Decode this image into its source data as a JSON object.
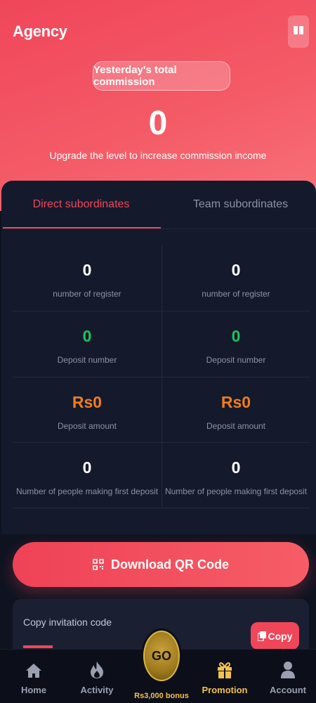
{
  "header": {
    "title": "Agency",
    "commission_label": "Yesterday's total commission",
    "commission_value": "0",
    "upgrade_text": "Upgrade the level to increase commission income"
  },
  "tabs": {
    "direct": "Direct subordinates",
    "team": "Team subordinates",
    "active": "direct"
  },
  "stats": [
    {
      "left": {
        "value": "0",
        "label": "number of register"
      },
      "right": {
        "value": "0",
        "label": "number of register"
      }
    },
    {
      "left": {
        "value": "0",
        "label": "Deposit number"
      },
      "right": {
        "value": "0",
        "label": "Deposit number"
      }
    },
    {
      "left": {
        "value": "Rs0",
        "label": "Deposit amount"
      },
      "right": {
        "value": "Rs0",
        "label": "Deposit amount"
      }
    },
    {
      "left": {
        "value": "0",
        "label": "Number of people making first deposit"
      },
      "right": {
        "value": "0",
        "label": "Number of people making first deposit"
      }
    }
  ],
  "actions": {
    "download_qr": "Download QR Code",
    "copy_invitation_label": "Copy invitation code",
    "copy_button": "Copy"
  },
  "nav": {
    "home": "Home",
    "activity": "Activity",
    "go": "GO",
    "bonus": "Rs3,000 bonus",
    "promotion": "Promotion",
    "account": "Account",
    "active": "promotion"
  },
  "colors": {
    "accent": "#f0465a",
    "green": "#21c05a",
    "orange": "#f07d1e",
    "gold": "#f2c14e",
    "panel": "#141a2b"
  },
  "icons": {
    "rules": "book-icon",
    "qr": "qr-code-icon",
    "copy": "copy-icon",
    "home": "home-icon",
    "activity": "flame-icon",
    "promotion": "gift-icon",
    "account": "user-icon"
  }
}
